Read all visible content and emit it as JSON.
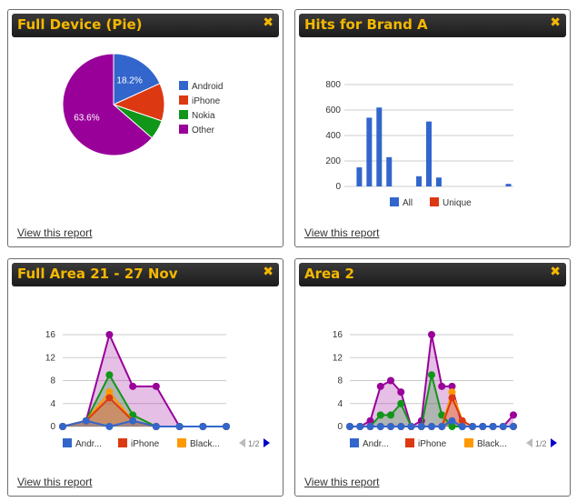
{
  "panels": {
    "pie": {
      "title": "Full Device (Pie)",
      "close": "✖",
      "link": "View this report"
    },
    "hits": {
      "title": "Hits for Brand A",
      "close": "✖",
      "link": "View this report"
    },
    "area1": {
      "title": "Full Area 21 - 27 Nov",
      "close": "✖",
      "link": "View this report"
    },
    "area2": {
      "title": "Area 2",
      "close": "✖",
      "link": "View this report"
    }
  },
  "colors": {
    "blue": "#3366cc",
    "red": "#dc3912",
    "green": "#109618",
    "orange": "#ff9900",
    "purple": "#990099",
    "title": "#f5b800"
  },
  "chart_data": [
    {
      "type": "pie",
      "slices": [
        {
          "label": "Android",
          "value": 18.2,
          "color": "#3366cc",
          "data_label": "18.2%"
        },
        {
          "label": "iPhone",
          "value": 12.0,
          "color": "#dc3912"
        },
        {
          "label": "Nokia",
          "value": 6.2,
          "color": "#109618"
        },
        {
          "label": "Other",
          "value": 63.6,
          "color": "#990099",
          "data_label": "63.6%"
        }
      ]
    },
    {
      "type": "bar",
      "ylim": [
        0,
        800
      ],
      "yticks": [
        "0",
        "200",
        "400",
        "600",
        "800"
      ],
      "series": [
        {
          "name": "All",
          "color": "#3366cc",
          "values": [
            0,
            150,
            540,
            620,
            230,
            0,
            0,
            80,
            510,
            70,
            0,
            0,
            0,
            0,
            0,
            0,
            20
          ]
        },
        {
          "name": "Unique",
          "color": "#dc3912",
          "values": [
            0,
            0,
            0,
            0,
            0,
            0,
            0,
            0,
            0,
            0,
            0,
            0,
            0,
            0,
            0,
            0,
            0
          ]
        }
      ]
    },
    {
      "type": "area",
      "ylim": [
        0,
        16
      ],
      "yticks": [
        "0",
        "4",
        "8",
        "12",
        "16"
      ],
      "legend": [
        "Andr...",
        "iPhone",
        "Black..."
      ],
      "pager": "1/2",
      "series": [
        {
          "name": "Andr...",
          "color": "#3366cc",
          "values": [
            0,
            1,
            0,
            1,
            0,
            0,
            0,
            0
          ]
        },
        {
          "name": "iPhone",
          "color": "#dc3912",
          "values": [
            0,
            1,
            5,
            1,
            0,
            0,
            0,
            0
          ]
        },
        {
          "name": "Black...",
          "color": "#ff9900",
          "values": [
            0,
            1,
            6,
            1,
            0,
            0,
            0,
            0
          ]
        },
        {
          "color": "#109618",
          "values": [
            0,
            1,
            9,
            2,
            0,
            0,
            0,
            0
          ]
        },
        {
          "color": "#990099",
          "values": [
            0,
            1,
            16,
            7,
            7,
            0,
            0,
            0
          ]
        }
      ]
    },
    {
      "type": "area",
      "ylim": [
        0,
        16
      ],
      "yticks": [
        "0",
        "4",
        "8",
        "12",
        "16"
      ],
      "legend": [
        "Andr...",
        "iPhone",
        "Black..."
      ],
      "pager": "1/2",
      "series": [
        {
          "name": "Andr...",
          "color": "#3366cc",
          "values": [
            0,
            0,
            0,
            0,
            0,
            0,
            0,
            0,
            0,
            0,
            1,
            0,
            0,
            0,
            0,
            0,
            0
          ]
        },
        {
          "name": "iPhone",
          "color": "#dc3912",
          "values": [
            0,
            0,
            0,
            0,
            0,
            0,
            0,
            0,
            0,
            0,
            5,
            1,
            0,
            0,
            0,
            0,
            0
          ]
        },
        {
          "name": "Black...",
          "color": "#ff9900",
          "values": [
            0,
            0,
            0,
            0,
            0,
            0,
            0,
            0,
            0,
            0,
            6,
            1,
            0,
            0,
            0,
            0,
            0
          ]
        },
        {
          "color": "#109618",
          "values": [
            0,
            0,
            0,
            2,
            2,
            4,
            0,
            0,
            9,
            2,
            0,
            0,
            0,
            0,
            0,
            0,
            0
          ]
        },
        {
          "color": "#990099",
          "values": [
            0,
            0,
            1,
            7,
            8,
            6,
            0,
            1,
            16,
            7,
            7,
            0,
            0,
            0,
            0,
            0,
            2
          ]
        }
      ]
    }
  ]
}
